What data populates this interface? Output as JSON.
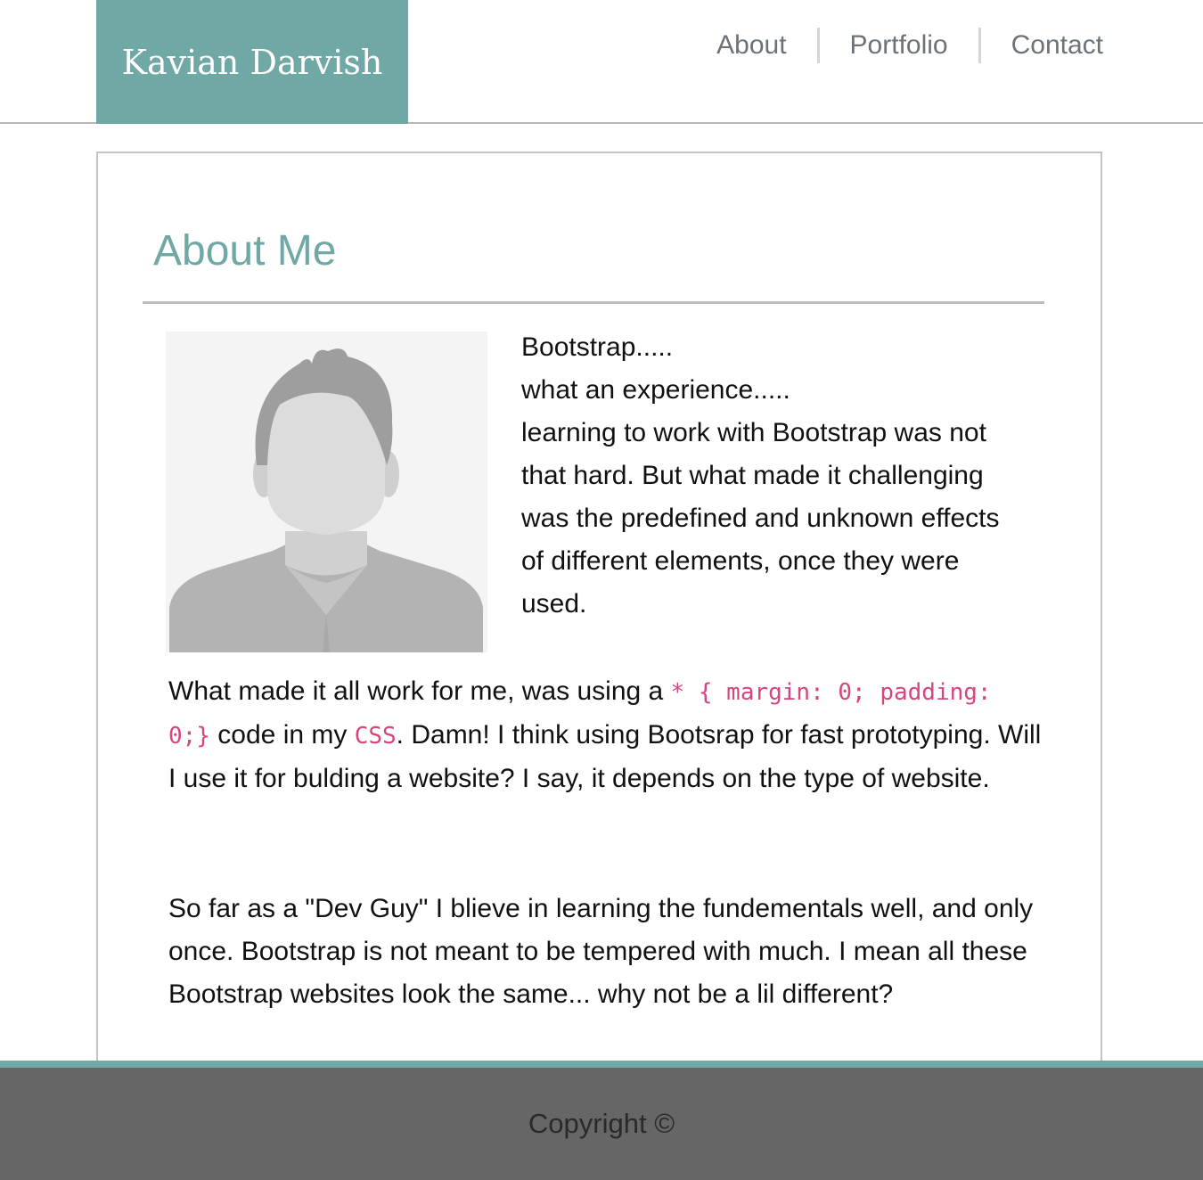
{
  "header": {
    "brand": "Kavian Darvish",
    "nav": [
      {
        "label": "About"
      },
      {
        "label": "Portfolio"
      },
      {
        "label": "Contact"
      }
    ]
  },
  "main": {
    "title": "About Me",
    "intro_lines": [
      "Bootstrap.....",
      "what an experience.....",
      "learning to work with Bootstrap was not that hard. But what made it challenging was the predefined and unknown effects of different elements, once they were used."
    ],
    "paragraph1": {
      "before_code": "What made it all work for me, was using a ",
      "code": "* { margin: 0; padding: 0;}",
      "middle": " code in my ",
      "code2": "CSS",
      "after": ". Damn! I think using Bootsrap for fast prototyping. Will I use it for bulding a website? I say, it depends on the type of website."
    },
    "paragraph2": "So far as a \"Dev Guy\" I blieve in learning the fundementals well, and only once. Bootstrap is not meant to be tempered with much. I mean all these Bootstrap websites look the same... why not be a lil different?",
    "avatar_icon": "user-silhouette-icon"
  },
  "footer": {
    "copyright": "Copyright ©"
  },
  "colors": {
    "accent": "#6fa8a5",
    "footer_bg": "#666666",
    "code": "#d6457f"
  }
}
